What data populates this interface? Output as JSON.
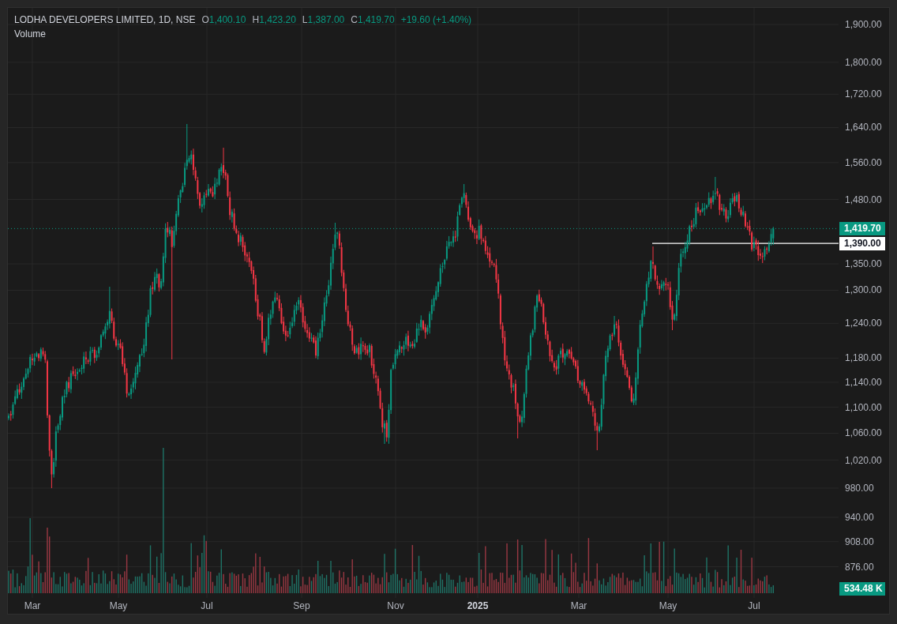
{
  "legend": {
    "symbol": "LODHA DEVELOPERS LIMITED, 1D, NSE",
    "rising": true,
    "fields": [
      {
        "label": "O",
        "value": "1,400.10"
      },
      {
        "label": "H",
        "value": "1,423.20"
      },
      {
        "label": "L",
        "value": "1,387.00"
      },
      {
        "label": "C",
        "value": "1,419.70"
      }
    ],
    "change": "+19.60 (+1.40%)"
  },
  "indicators": [
    {
      "name": "Volume"
    }
  ],
  "price_axis": {
    "labels": [
      "1,900.00",
      "1,800.00",
      "1,720.00",
      "1,640.00",
      "1,560.00",
      "1,480.00",
      "1,350.00",
      "1,300.00",
      "1,240.00",
      "1,180.00",
      "1,140.00",
      "1,100.00",
      "1,060.00",
      "1,020.00",
      "980.00",
      "940.00",
      "908.00",
      "876.00"
    ]
  },
  "price_markers": [
    {
      "kind": "last-price",
      "text": "1,419.70"
    },
    {
      "kind": "horizontal-line",
      "text": "1,390.00"
    }
  ],
  "volume_marker": {
    "rising": true,
    "text": "534.48 K"
  },
  "time_axis": {
    "labels": [
      {
        "kind": "month",
        "text": "Mar"
      },
      {
        "kind": "month",
        "text": "May"
      },
      {
        "kind": "month",
        "text": "Jul"
      },
      {
        "kind": "month",
        "text": "Sep"
      },
      {
        "kind": "month",
        "text": "Nov"
      },
      {
        "kind": "year",
        "text": "2025"
      },
      {
        "kind": "month",
        "text": "Mar"
      },
      {
        "kind": "month",
        "text": "May"
      },
      {
        "kind": "month",
        "text": "Jul"
      }
    ]
  }
}
